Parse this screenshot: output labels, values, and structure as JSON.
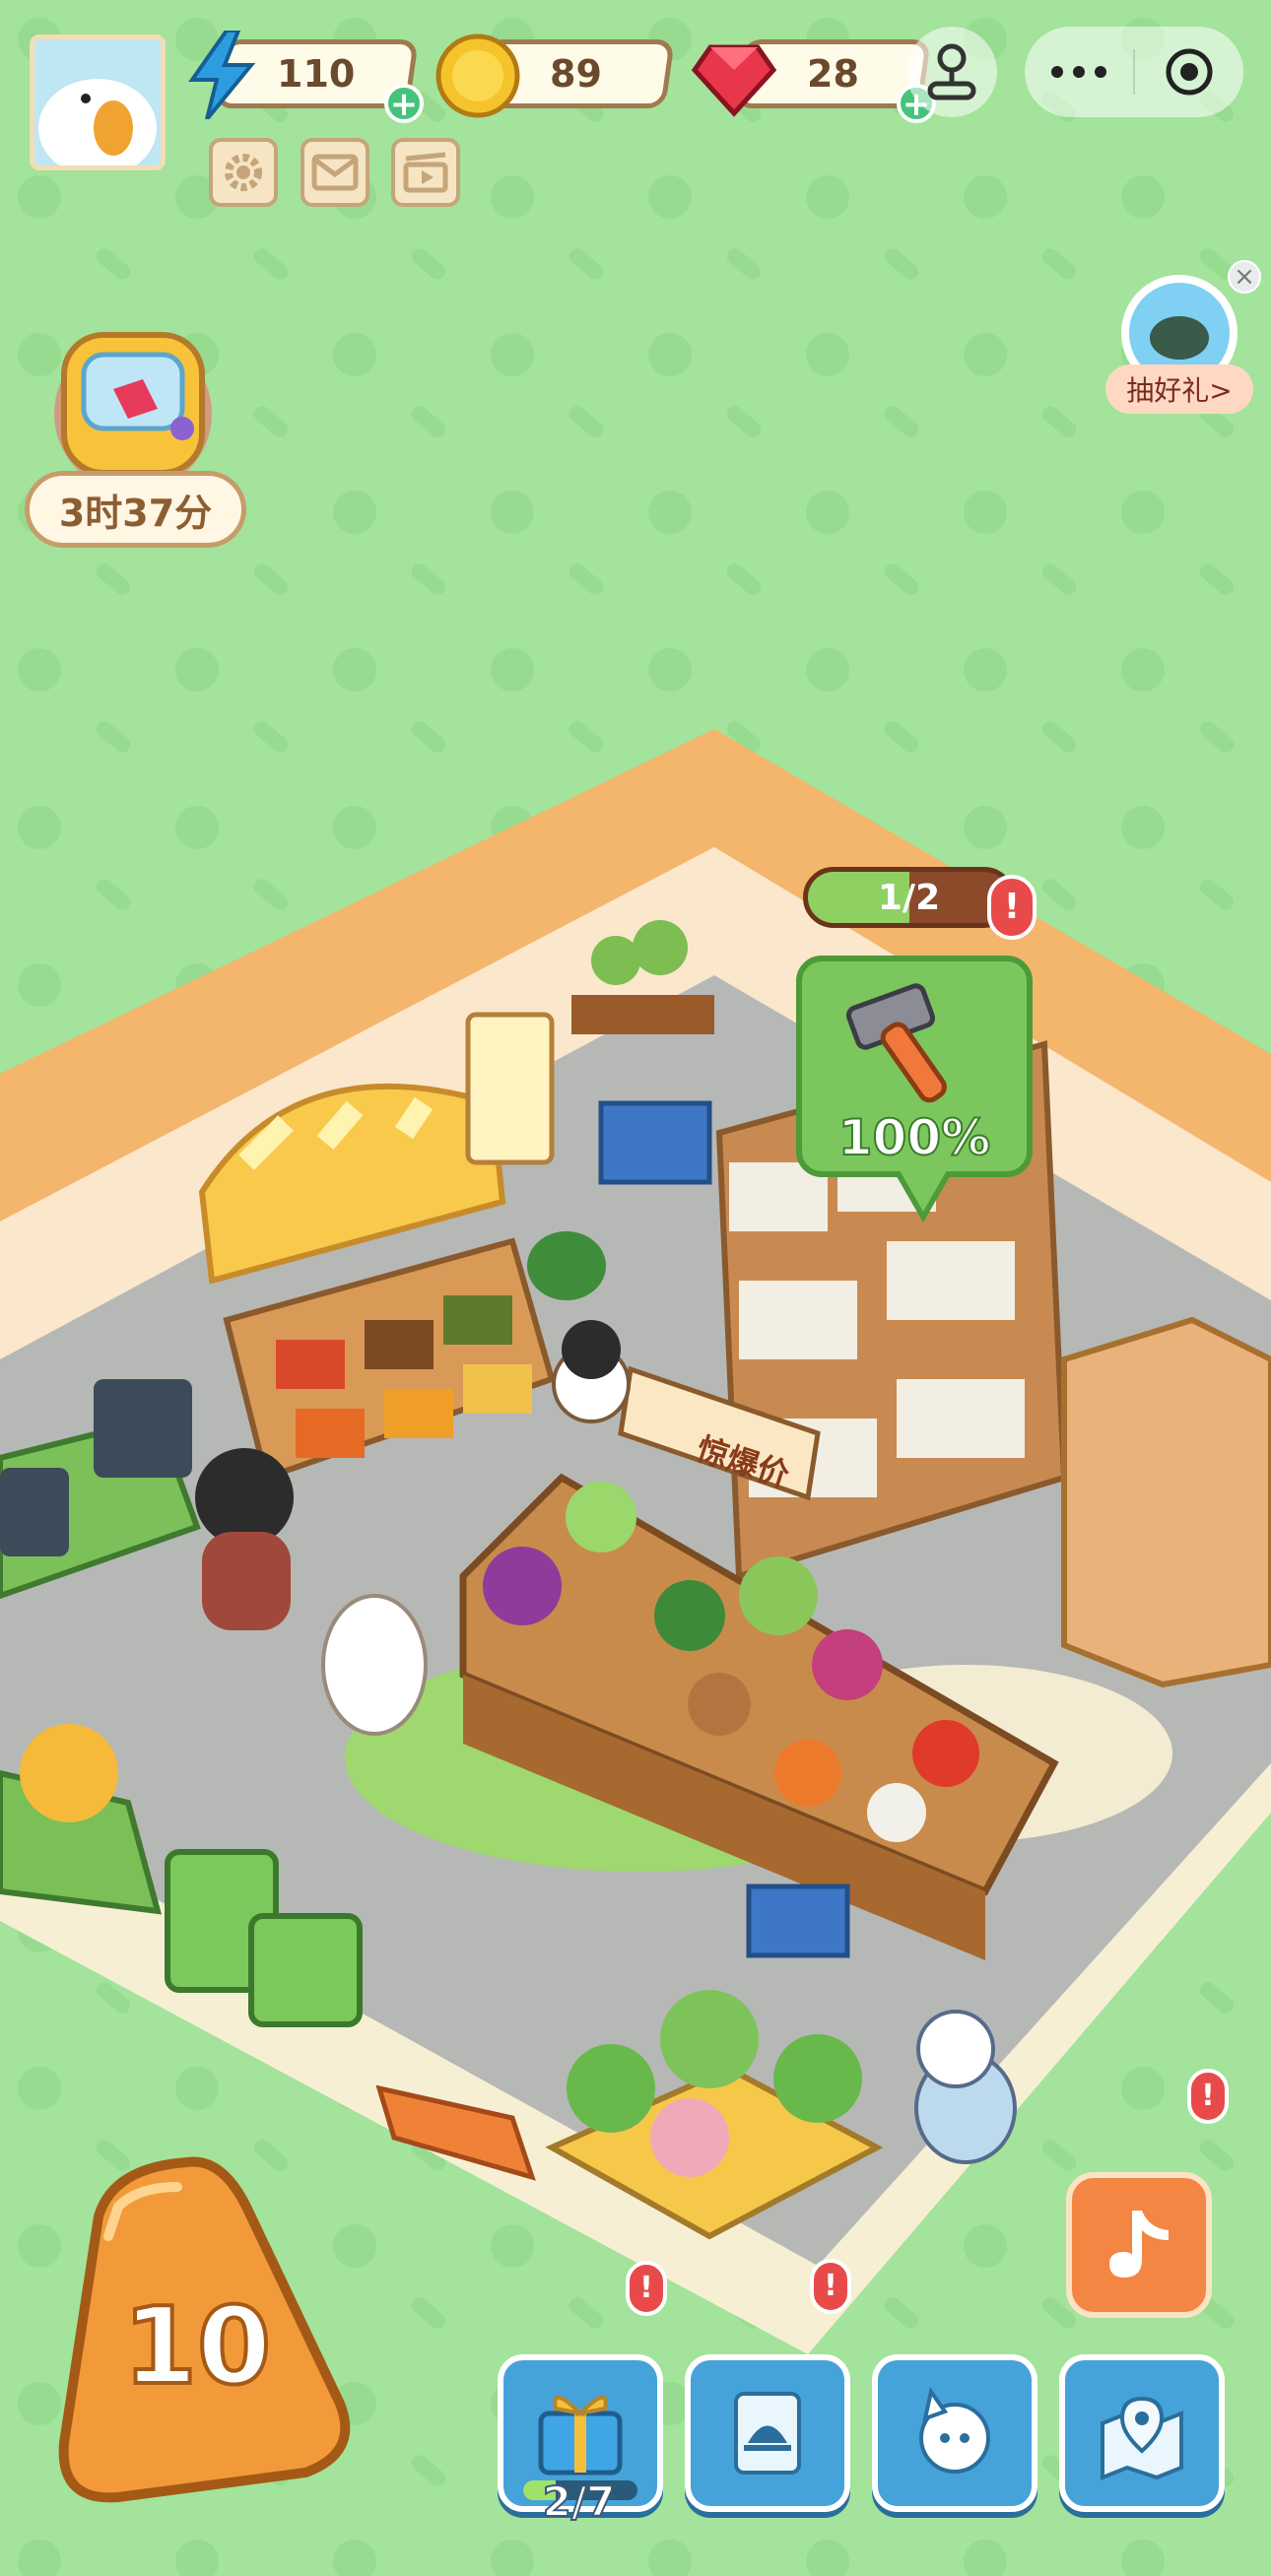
{
  "hud": {
    "energy": "110",
    "coins": "89",
    "gems": "28",
    "timer": "3时37分",
    "gift_label": "抽好礼>"
  },
  "task": {
    "progress_label": "1/2",
    "progress_value": 0.5,
    "build_percent": "100%"
  },
  "store": {
    "sale_sign": "惊爆价"
  },
  "bottom": {
    "level": "10",
    "quest_progress": "2/7",
    "quest_progress_value": 0.2857
  },
  "icons": {
    "energy": "lightning-icon",
    "coin": "coin-icon",
    "gem": "ruby-icon",
    "settings": "gear-icon",
    "mail": "mail-icon",
    "video": "clapperboard-icon",
    "menu": "more-dots-icon",
    "close_app": "target-icon",
    "joystick": "joystick-icon",
    "hammer": "hammer-icon",
    "gift": "gift-box-icon",
    "recipe": "service-bell-icon",
    "pet": "cat-face-icon",
    "map": "map-pin-icon",
    "tiktok": "music-note-icon"
  },
  "colors": {
    "background": "#a3e39b",
    "accent_green": "#7cc75d",
    "alert_red": "#e84a4a",
    "button_blue": "#46a3d9",
    "level_orange": "#f29a3a"
  }
}
